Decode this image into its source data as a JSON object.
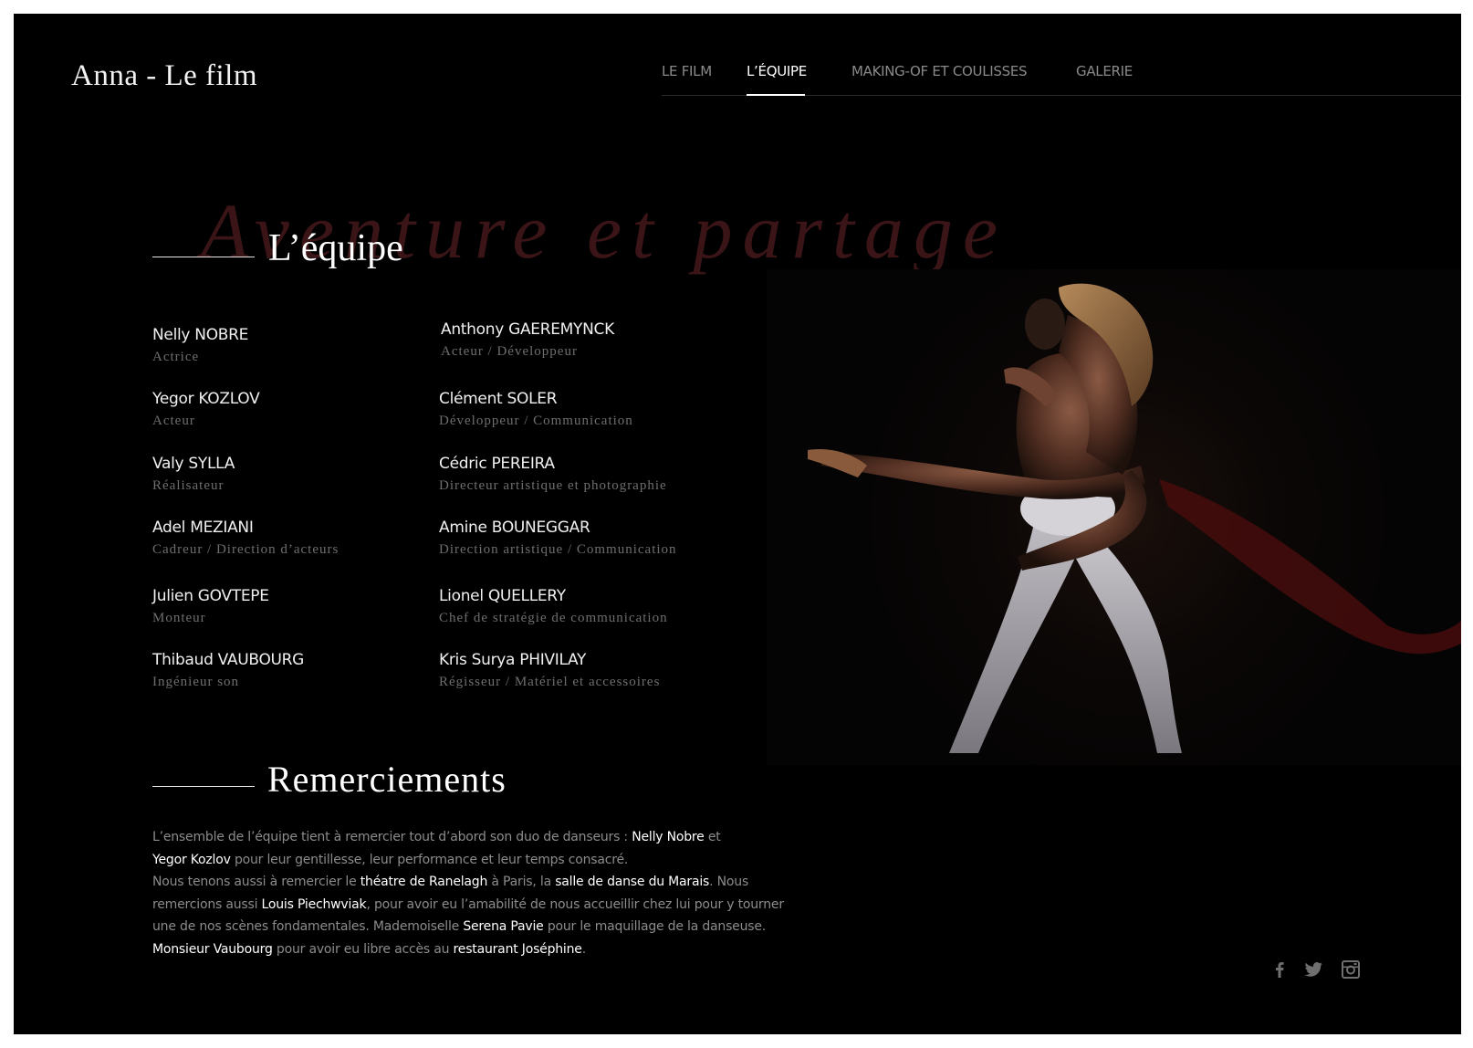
{
  "brand": {
    "logo": "Anna - Le film"
  },
  "nav": {
    "items": [
      {
        "label": "LE FILM",
        "active": false
      },
      {
        "label": "L’ÉQUIPE",
        "active": true
      },
      {
        "label": "MAKING-OF ET COULISSES",
        "active": false
      },
      {
        "label": "GALERIE",
        "active": false
      }
    ]
  },
  "hero": {
    "background_text": "Aventure et partage"
  },
  "team": {
    "title": "L’équipe",
    "members": [
      {
        "name": "Nelly NOBRE",
        "role": "Actrice"
      },
      {
        "name": "Anthony GAEREMYNCK",
        "role": "Acteur / Développeur"
      },
      {
        "name": "Yegor KOZLOV",
        "role": "Acteur"
      },
      {
        "name": "Clément SOLER",
        "role": "Développeur / Communication"
      },
      {
        "name": "Valy SYLLA",
        "role": "Réalisateur"
      },
      {
        "name": "Cédric PEREIRA",
        "role": "Directeur artistique et photographie"
      },
      {
        "name": "Adel MEZIANI",
        "role": "Cadreur / Direction d’acteurs"
      },
      {
        "name": "Amine BOUNEGGAR",
        "role": "Direction artistique / Communication"
      },
      {
        "name": "Julien GOVTEPE",
        "role": "Monteur"
      },
      {
        "name": "Lionel QUELLERY",
        "role": "Chef de stratégie de communication"
      },
      {
        "name": "Thibaud VAUBOURG",
        "role": "Ingénieur son"
      },
      {
        "name": "Kris Surya PHIVILAY",
        "role": "Régisseur / Matériel et accessoires"
      }
    ]
  },
  "thanks": {
    "title": "Remerciements",
    "segments": [
      {
        "text": "L’ensemble de l’équipe tient à remercier tout d’abord son duo de danseurs : ",
        "highlight": false
      },
      {
        "text": "Nelly Nobre",
        "highlight": true
      },
      {
        "text": " et ",
        "highlight": false
      },
      {
        "text": "Yegor Kozlov",
        "highlight": true
      },
      {
        "text": " pour leur gentillesse, leur performance et leur temps consacré.",
        "highlight": false
      },
      {
        "text": "Nous tenons aussi à remercier le ",
        "highlight": false
      },
      {
        "text": "théatre de Ranelagh",
        "highlight": true
      },
      {
        "text": " à Paris, la ",
        "highlight": false
      },
      {
        "text": "salle de danse du Marais",
        "highlight": true
      },
      {
        "text": ". Nous remercions aussi ",
        "highlight": false
      },
      {
        "text": "Louis Piechwviak",
        "highlight": true
      },
      {
        "text": ", pour avoir eu l’amabilité de nous accueillir chez lui pour y tourner une de nos scènes fondamentales. Mademoiselle ",
        "highlight": false
      },
      {
        "text": "Serena Pavie",
        "highlight": true
      },
      {
        "text": " pour le maquillage de la danseuse. ",
        "highlight": false
      },
      {
        "text": "Monsieur Vaubourg",
        "highlight": true
      },
      {
        "text": " pour avoir eu libre accès au ",
        "highlight": false
      },
      {
        "text": "restaurant Joséphine",
        "highlight": true
      },
      {
        "text": ".",
        "highlight": false
      }
    ]
  },
  "social": {
    "icons": [
      "facebook-icon",
      "twitter-icon",
      "instagram-icon"
    ]
  },
  "colors": {
    "background": "#000000",
    "text": "#ffffff",
    "muted": "#8c8c8c",
    "accent_script": "#3a1416"
  }
}
